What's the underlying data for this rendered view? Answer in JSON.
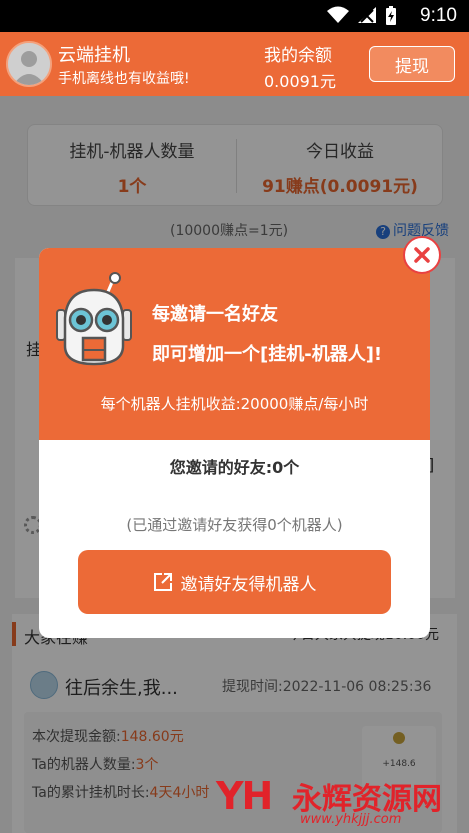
{
  "status_bar": {
    "time": "9:10"
  },
  "header": {
    "app_name": "云端挂机",
    "app_subtitle": "手机离线也有收益哦!",
    "balance_label": "我的余额",
    "balance_value": "0.0091元",
    "withdraw_label": "提现"
  },
  "stats": {
    "robots_label": "挂机-机器人数量",
    "robots_value": "1个",
    "today_label": "今日收益",
    "today_value": "91赚点(0.0091元)",
    "rate_note": "(10000赚点=1元)",
    "feedback_label": "问题反馈"
  },
  "background": {
    "side_text": "挂",
    "right_bracket": "]"
  },
  "dialog": {
    "line1": "每邀请一名好友",
    "line2": "即可增加一个[挂机-机器人]!",
    "earn_rate": "每个机器人挂机收益:20000赚点/每小时",
    "invited_label": "您邀请的好友:",
    "invited_count": "0个",
    "obtained_text": "(已通过邀请好友获得0个机器人)",
    "invite_button": "邀请好友得机器人"
  },
  "list": {
    "title": "大家在赚",
    "right_text": "今日大家共提现10.00元",
    "user_name": "往后余生,我...",
    "withdraw_time_label": "提现时间:",
    "withdraw_time": "2022-11-06 08:25:36",
    "rows": [
      {
        "label": "本次提现金额:",
        "value": "148.60元"
      },
      {
        "label": "Ta的机器人数量:",
        "value": "3个"
      },
      {
        "label": "Ta的累计挂机时长:",
        "value": "4天4小时"
      }
    ],
    "receipt_amount": "+148.6"
  },
  "watermark": {
    "logo": "YH",
    "name": "永辉资源网",
    "url": "www.yhkjjj.com"
  },
  "colors": {
    "brand": "#ec6a37",
    "accent_text": "#e9662f",
    "close_red": "#e94141",
    "watermark_red": "#e1232a"
  }
}
